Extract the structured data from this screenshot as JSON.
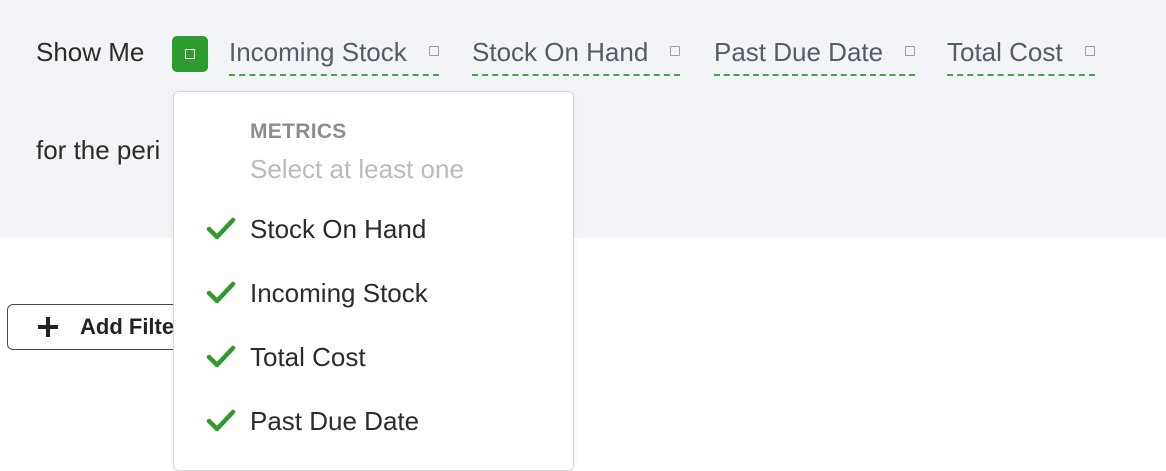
{
  "header": {
    "show_me_label": "Show Me",
    "period_label": "for the peri"
  },
  "metrics": [
    {
      "label": "Incoming Stock"
    },
    {
      "label": "Stock On Hand"
    },
    {
      "label": "Past Due Date"
    },
    {
      "label": "Total Cost"
    }
  ],
  "filters": {
    "add_label": "Add Filte"
  },
  "dropdown": {
    "header": "METRICS",
    "hint": "Select at least one",
    "items": [
      {
        "label": "Stock On Hand",
        "checked": true
      },
      {
        "label": "Incoming Stock",
        "checked": true
      },
      {
        "label": "Total Cost",
        "checked": true
      },
      {
        "label": "Past Due Date",
        "checked": true
      }
    ]
  },
  "colors": {
    "accent_green": "#2e9b2e",
    "panel_background": "#f3f4f8",
    "dashed_underline": "#43a843"
  },
  "icons": {
    "toggle": "square-icon",
    "metric_marker": "square-icon",
    "add": "plus-icon",
    "selected": "check-icon"
  }
}
